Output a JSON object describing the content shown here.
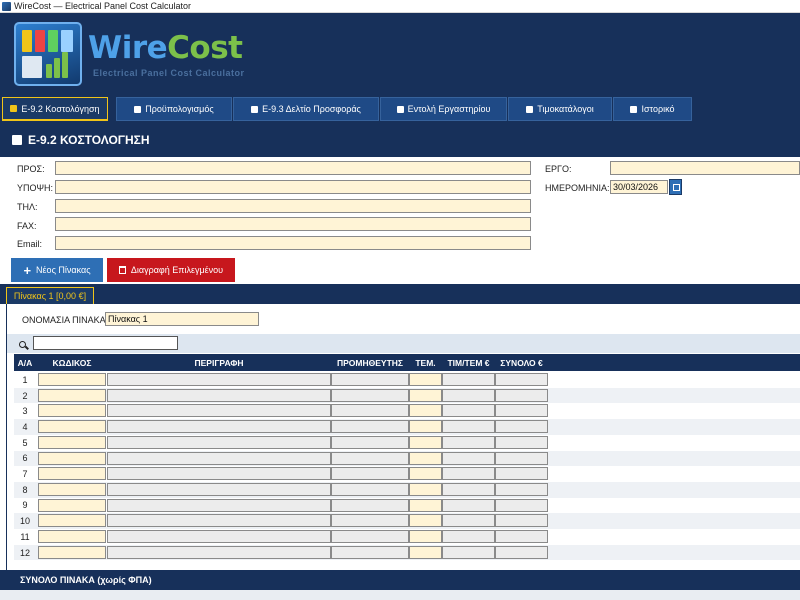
{
  "window": {
    "title": "WireCost — Electrical Panel Cost Calculator"
  },
  "brand": {
    "name_part1": "Wire",
    "name_part2": "Cost",
    "tagline": "Electrical Panel Cost Calculator"
  },
  "tabs": [
    {
      "label": "Ε-9.2 Κοστολόγηση",
      "active": true
    },
    {
      "label": "Προϋπολογισμός",
      "active": false
    },
    {
      "label": "Ε-9.3 Δελτίο Προσφοράς",
      "active": false
    },
    {
      "label": "Εντολή Εργαστηρίου",
      "active": false
    },
    {
      "label": "Τιμοκατάλογοι",
      "active": false
    },
    {
      "label": "Ιστορικό",
      "active": false
    }
  ],
  "section": {
    "title": "Ε-9.2  ΚΟΣΤΟΛΟΓΗΣΗ"
  },
  "form": {
    "pros_label": "ΠΡΟΣ:",
    "ypopsi_label": "ΥΠΟΨΗ:",
    "til_label": "ΤΗΛ:",
    "fax_label": "FAX:",
    "email_label": "Email:",
    "ergo_label": "ΕΡΓΟ:",
    "date_label": "ΗΜΕΡΟΜΗΝΙΑ:",
    "date_value": "30/03/2026"
  },
  "actions": {
    "new_panel": "Νέος Πίνακας",
    "delete_selected": "Διαγραφή Επιλεγμένου"
  },
  "panel": {
    "tab_label": "Πίνακας 1 [0,00 €]",
    "name_label": "ΟΝΟΜΑΣΙΑ ΠΙΝΑΚΑ:",
    "name_value": "Πίνακας 1"
  },
  "table": {
    "headers": [
      "Α/Α",
      "ΚΩΔΙΚΟΣ",
      "ΠΕΡΙΓΡΑΦΗ",
      "ΠΡΟΜΗΘΕΥΤΗΣ",
      "ΤΕΜ.",
      "ΤΙΜ/ΤΕΜ €",
      "ΣΥΝΟΛΟ €"
    ],
    "rows": [
      "1",
      "2",
      "3",
      "4",
      "5",
      "6",
      "7",
      "8",
      "9",
      "10",
      "11",
      "12"
    ]
  },
  "footer": {
    "total_label": "ΣΥΝΟΛΟ ΠΙΝΑΚΑ (χωρίς ΦΠΑ)"
  },
  "colors": {
    "navy": "#17305a",
    "accent_yellow": "#f0c419",
    "button_blue": "#2e6fb5",
    "button_red": "#c7171d",
    "input_cream": "#fff4d6"
  }
}
